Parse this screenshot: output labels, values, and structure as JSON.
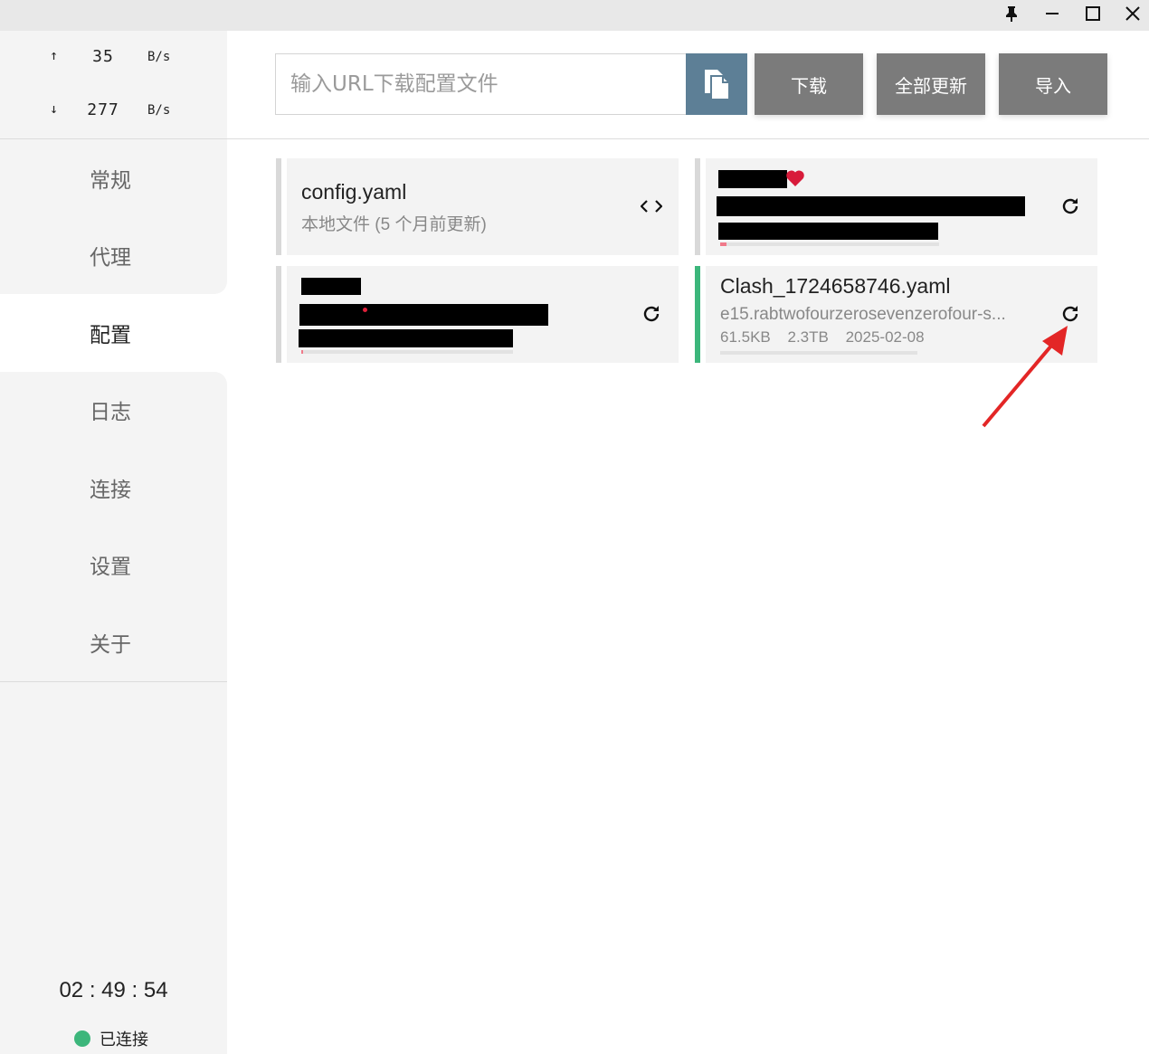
{
  "window": {
    "pin_icon": "pin-icon",
    "minimize_icon": "minimize-icon",
    "maximize_icon": "maximize-icon",
    "close_icon": "close-icon"
  },
  "traffic": {
    "up": {
      "arrow": "↑",
      "value": "35",
      "unit": "B/s"
    },
    "down": {
      "arrow": "↓",
      "value": "277",
      "unit": "B/s"
    }
  },
  "nav": {
    "items": [
      {
        "label": "常规"
      },
      {
        "label": "代理"
      },
      {
        "label": "配置"
      },
      {
        "label": "日志"
      },
      {
        "label": "连接"
      },
      {
        "label": "设置"
      },
      {
        "label": "关于"
      }
    ],
    "active_index": 2
  },
  "clock": "02 : 49 : 54",
  "status": {
    "label": "已连接",
    "color": "#3cb67b"
  },
  "toolbar": {
    "url_placeholder": "输入URL下载配置文件",
    "url_value": "",
    "paste_icon": "paste-icon",
    "download_label": "下载",
    "update_all_label": "全部更新",
    "import_label": "导入"
  },
  "profiles": [
    {
      "title": "config.yaml",
      "subtitle": "本地文件 (5 个月前更新)",
      "icon": "code-icon"
    },
    {
      "title": "",
      "subtitle": "",
      "icon": "refresh-icon",
      "usage": 0.03
    },
    {
      "title": "",
      "subtitle": "",
      "icon": "refresh-icon",
      "usage": 0.01
    },
    {
      "title": "Clash_1724658746.yaml",
      "subtitle": "e15.rabtwofourzerosevenzerofour-s...",
      "size": "61.5KB",
      "total": "2.3TB",
      "expire": "2025-02-08",
      "icon": "refresh-icon",
      "selected": true,
      "usage": 0.0
    }
  ],
  "colors": {
    "accent": "#5d7f96",
    "button": "#7b7b7b",
    "selected_bar": "#3cb67b",
    "annotation_arrow": "#e32626"
  }
}
